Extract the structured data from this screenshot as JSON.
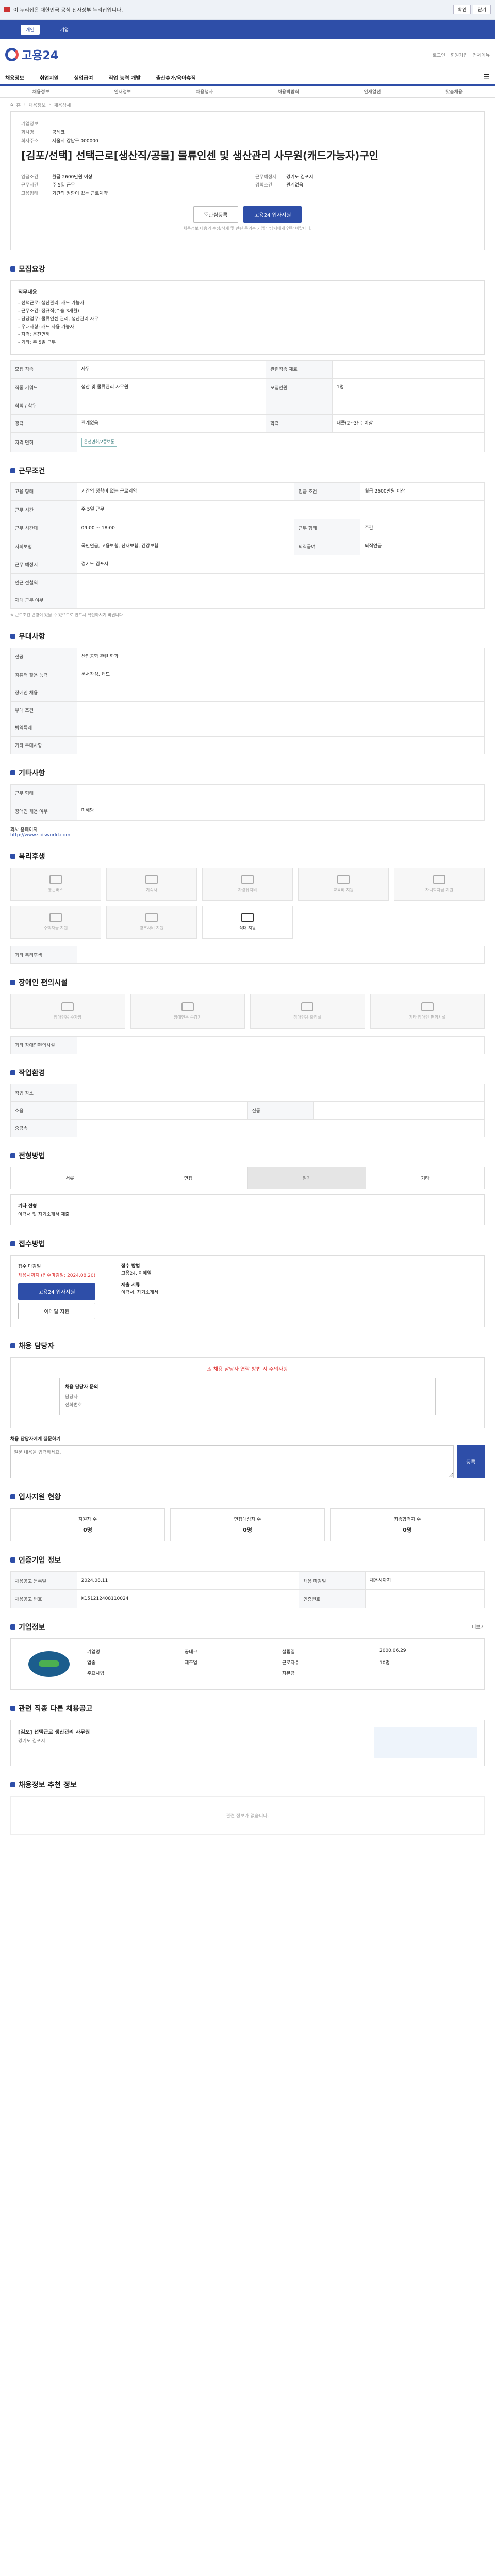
{
  "banner": {
    "text": "이 누리집은 대한민국 공식 전자정부 누리집입니다.",
    "btn1": "확인",
    "btn2": "닫기"
  },
  "topnav": {
    "items": [
      "개인",
      "기업"
    ]
  },
  "header": {
    "logo": "고용24",
    "util": [
      "로그인",
      "회원가입",
      "전체메뉴"
    ]
  },
  "gnb": {
    "items": [
      "채용정보",
      "취업지원",
      "실업급여",
      "직업 능력 개발",
      "출산휴가/육아휴직"
    ]
  },
  "subnav": {
    "items": [
      "채용정보",
      "인재정보",
      "채용행사",
      "채용박람회",
      "인재알선",
      "맞춤채용"
    ]
  },
  "crumb": {
    "items": [
      "홈",
      "채용정보",
      "채용상세"
    ]
  },
  "job": {
    "company_label": "기업정보",
    "company_name_k": "회사명",
    "company_name": "공테크",
    "rep_k": "대표자",
    "rep": "",
    "addr_k": "회사주소",
    "addr": "서울시 강남구 000000",
    "title": "[김포/선택] 선택근로[생산직/공물] 물류인센 및 생산관리 사무원(캐드가능자)구인",
    "wage_k": "임금조건",
    "wage": "월급 2600만원 이상",
    "worktime_k": "근무시간",
    "worktime": "주 5일 근무",
    "place_k": "근무예정지",
    "place": "경기도 김포시",
    "form_k": "고용형태",
    "form": "기간의 정함이 없는 근로계약",
    "career_k": "경력조건",
    "career": "관계없음",
    "scrap": "관심등록",
    "apply": "고용24 입사지원",
    "notice": "채용정보 내용의 수정/삭제 및 관련 문의는 기업 담당자에게 연락 바랍니다."
  },
  "desc": {
    "title": "모집요강",
    "heading": "직무내용",
    "lines": [
      "- 선택근로: 생산관리, 캐드 가능자",
      "- 근무조건: 정규직(수습 3개월)",
      "- 담당업무: 물류인센 관리, 생산관리 사무",
      "- 우대사항: 캐드 사용 가능자",
      "- 자격: 운전면허",
      "- 기타: 주 5일 근무"
    ]
  },
  "recruit": {
    "rows": [
      {
        "k1": "모집 직종",
        "v1": "사무",
        "k2": "관련직종 재료",
        "v2": ""
      },
      {
        "k1": "직종 키워드",
        "v1": "생산 및 물류관리 사무원",
        "k2": "모집인원",
        "v2": "1명"
      },
      {
        "k1": "학력 / 학위",
        "v1": "",
        "k2": "",
        "v2": ""
      },
      {
        "k1": "경력",
        "v1": "관계없음",
        "k2": "학력",
        "v2": "대졸(2~3년) 이상"
      },
      {
        "k1": "자격 면허",
        "v1": "운전면허/2종보통",
        "k2": "",
        "v2": ""
      }
    ]
  },
  "cond": {
    "title": "근무조건",
    "rows": [
      {
        "k1": "고용 형태",
        "v1": "기간의 정함이 없는 근로계약",
        "k2": "임금 조건",
        "v2": "월급 2600만원 이상"
      },
      {
        "k1": "근무 시간",
        "v1": "주 5일 근무",
        "k2": "",
        "v2": ""
      },
      {
        "k1": "근무 시간대",
        "v1": "09:00 ~ 18:00",
        "k2": "근무 형태",
        "v2": "주간"
      },
      {
        "k1": "사회보험",
        "v1": "국민연금, 고용보험, 산재보험, 건강보험",
        "k2": "퇴직급여",
        "v2": "퇴직연금"
      },
      {
        "k1": "근무 예정지",
        "v1": "경기도 김포시",
        "k2": "",
        "v2": ""
      },
      {
        "k1": "인근 전철역",
        "v1": "",
        "k2": "",
        "v2": ""
      },
      {
        "k1": "재택 근무 여부",
        "v1": "",
        "k2": "",
        "v2": ""
      }
    ],
    "footnote": "※ 근로조건 변경이 있을 수 있으므로 반드시 확인하시기 바랍니다."
  },
  "welfare": {
    "title": "우대사항",
    "rows": [
      {
        "k": "전공",
        "v": "산업공학 관련 학과"
      },
      {
        "k": "컴퓨터 활용 능력",
        "v": "문서작성, 캐드"
      },
      {
        "k": "장애인 채용",
        "v": ""
      },
      {
        "k": "우대 조건",
        "v": ""
      },
      {
        "k": "병역특례",
        "v": ""
      },
      {
        "k": "기타 우대사항",
        "v": ""
      }
    ]
  },
  "etc": {
    "title": "기타사항",
    "rows": [
      {
        "k": "근무 형태",
        "v": ""
      },
      {
        "k": "장애인 채용 여부",
        "v": "미해당"
      }
    ],
    "link_label": "회사 홈페이지",
    "link_url": "http://www.sidsworld.com"
  },
  "benefit": {
    "title": "복리후생",
    "items": [
      "통근버스",
      "기숙사",
      "차량유지비",
      "교육비 지원",
      "자녀학자금 지원",
      "주택자금 지원",
      "경조사비 지원",
      "식대 지원"
    ],
    "extra_k": "기타 복리후생",
    "extra_v": ""
  },
  "disability": {
    "title": "장애인 편의시설",
    "items": [
      "장애인용 주차장",
      "장애인용 승강기",
      "장애인용 화장실",
      "기타 장애인 편의시설"
    ],
    "extra_k": "기타 장애인편의시설",
    "extra_v": ""
  },
  "work_env": {
    "title": "작업환경",
    "rows": [
      {
        "k1": "작업 장소",
        "v1": "",
        "k2": "",
        "v2": ""
      },
      {
        "k1": "소음",
        "v1": "",
        "k2": "진동",
        "v2": ""
      },
      {
        "k1": "중금속",
        "v1": "",
        "k2": "",
        "v2": ""
      }
    ]
  },
  "process": {
    "title": "전형방법",
    "steps": [
      "서류",
      "면접",
      "필기",
      "기타"
    ],
    "extra_k": "기타 전형",
    "extra_v": "이력서 및 자기소개서 제출"
  },
  "apply": {
    "title": "접수방법",
    "deadline_k": "접수 마감일",
    "deadline": "채용시까지 (접수마감일: 2024.08.20)",
    "method_k": "접수 방법",
    "method": "고용24, 이메일",
    "docs_k": "제출 서류",
    "docs": "이력서, 자기소개서",
    "apply_btn": "고용24 입사지원",
    "email_btn": "이메일 지원"
  },
  "manager": {
    "title": "채용 담당자",
    "warn": "채용 담당자 연락 방법 시 주의사항",
    "box_title": "채용 담당자 문의",
    "name_k": "담당자",
    "name": "",
    "tel_k": "전화번호",
    "tel": "",
    "qa_title": "채용 담당자에게 질문하기",
    "qa_ph": "질문 내용을 입력하세요.",
    "qa_submit": "등록"
  },
  "stats": {
    "title": "입사지원 현황",
    "items": [
      {
        "k": "지원자 수",
        "v": "0명"
      },
      {
        "k": "면접대상자 수",
        "v": "0명"
      },
      {
        "k": "최종합격자 수",
        "v": "0명"
      }
    ]
  },
  "info": {
    "title": "인증기업 정보",
    "rows": [
      {
        "k1": "채용공고 등록일",
        "v1": "2024.08.11",
        "k2": "채용 마감일",
        "v2": "채용시까지"
      },
      {
        "k1": "채용공고 번호",
        "v1": "K151212408110024",
        "k2": "인증번호",
        "v2": ""
      }
    ]
  },
  "company": {
    "title": "기업정보",
    "rows": [
      {
        "k1": "기업명",
        "v1": "공테크",
        "k2": "설립일",
        "v2": "2000.06.29"
      },
      {
        "k1": "업종",
        "v1": "제조업",
        "k2": "근로자수",
        "v2": "10명"
      },
      {
        "k1": "주요사업",
        "v1": "",
        "k2": "자본금",
        "v2": ""
      }
    ],
    "btn_more": "더보기"
  },
  "related": {
    "title": "관련 직종 다른 채용공고",
    "card_title": "[김포] 선택근로 생산관리 사무원",
    "card_sub": "경기도 김포시"
  },
  "recommend": {
    "title": "채용정보 추천 정보",
    "empty": "관련 정보가 없습니다."
  }
}
